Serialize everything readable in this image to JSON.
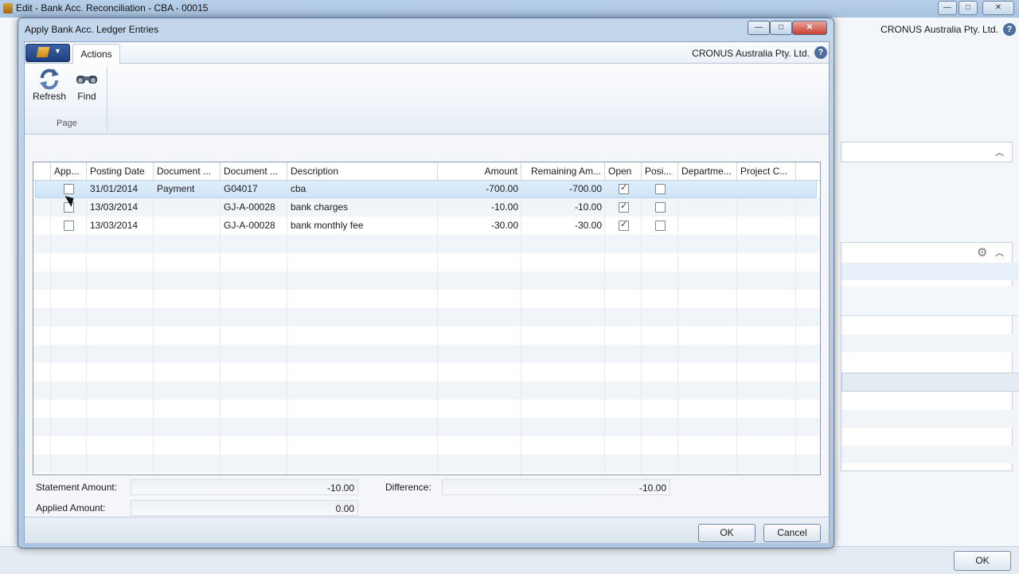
{
  "background_window": {
    "title": "Edit - Bank Acc. Reconciliation - CBA - 00015",
    "company": "CRONUS Australia Pty. Ltd.",
    "ok_label": "OK"
  },
  "dialog": {
    "title": "Apply Bank Acc. Ledger Entries",
    "window_buttons": {
      "minimize": "—",
      "maximize": "□",
      "close": "✕"
    }
  },
  "ribbon": {
    "tab_label": "Actions",
    "company": "CRONUS Australia Pty. Ltd.",
    "help": "?",
    "buttons": [
      {
        "label": "Refresh",
        "icon": "refresh-icon"
      },
      {
        "label": "Find",
        "icon": "binoculars-icon"
      }
    ],
    "group_label": "Page"
  },
  "table": {
    "columns": [
      "App...",
      "Posting Date",
      "Document ...",
      "Document ...",
      "Description",
      "Amount",
      "Remaining Am...",
      "Open",
      "Posi...",
      "Departme...",
      "Project C..."
    ],
    "rows": [
      {
        "applied": false,
        "posting_date": "31/01/2014",
        "doc_type": "Payment",
        "doc_no": "G04017",
        "description": "cba",
        "amount": "-700.00",
        "remaining": "-700.00",
        "open": true,
        "positive": false,
        "department": "",
        "project": ""
      },
      {
        "applied": false,
        "posting_date": "13/03/2014",
        "doc_type": "",
        "doc_no": "GJ-A-00028",
        "description": "bank charges",
        "amount": "-10.00",
        "remaining": "-10.00",
        "open": true,
        "positive": false,
        "department": "",
        "project": ""
      },
      {
        "applied": false,
        "posting_date": "13/03/2014",
        "doc_type": "",
        "doc_no": "GJ-A-00028",
        "description": "bank monthly fee",
        "amount": "-30.00",
        "remaining": "-30.00",
        "open": true,
        "positive": false,
        "department": "",
        "project": ""
      }
    ]
  },
  "totals": {
    "statement_amount_label": "Statement Amount:",
    "statement_amount": "-10.00",
    "applied_amount_label": "Applied Amount:",
    "applied_amount": "0.00",
    "difference_label": "Difference:",
    "difference": "-10.00"
  },
  "footer": {
    "ok_label": "OK",
    "cancel_label": "Cancel"
  }
}
